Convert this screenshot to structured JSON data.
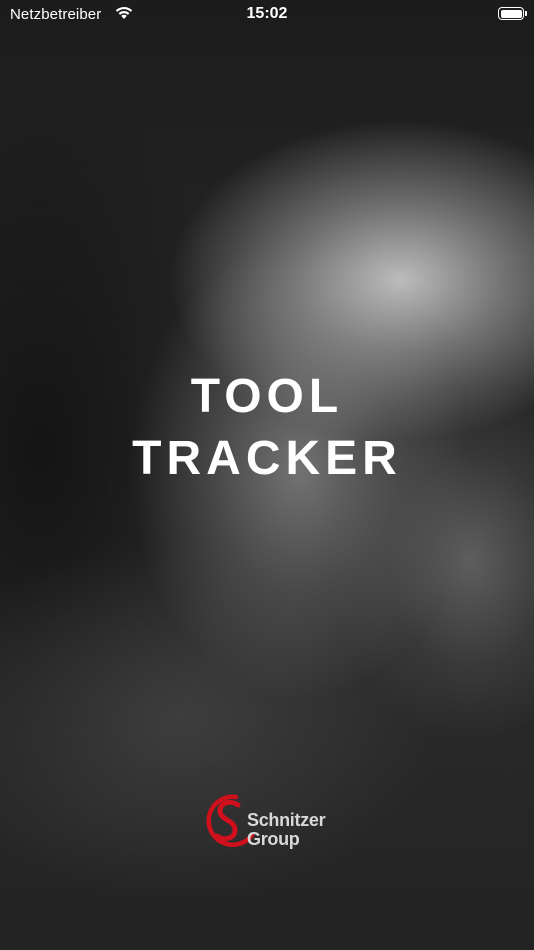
{
  "status_bar": {
    "carrier": "Netzbetreiber",
    "time": "15:02",
    "wifi_icon": "wifi-icon",
    "battery_icon": "battery-full-icon"
  },
  "splash": {
    "title_line1": "TOOL",
    "title_line2": "TRACKER"
  },
  "logo": {
    "icon": "schnitzer-s-logo-icon",
    "name_line1": "Schnitzer",
    "name_line2": "Group",
    "brand_color": "#d0101c",
    "text_color": "#d8d8d8"
  }
}
